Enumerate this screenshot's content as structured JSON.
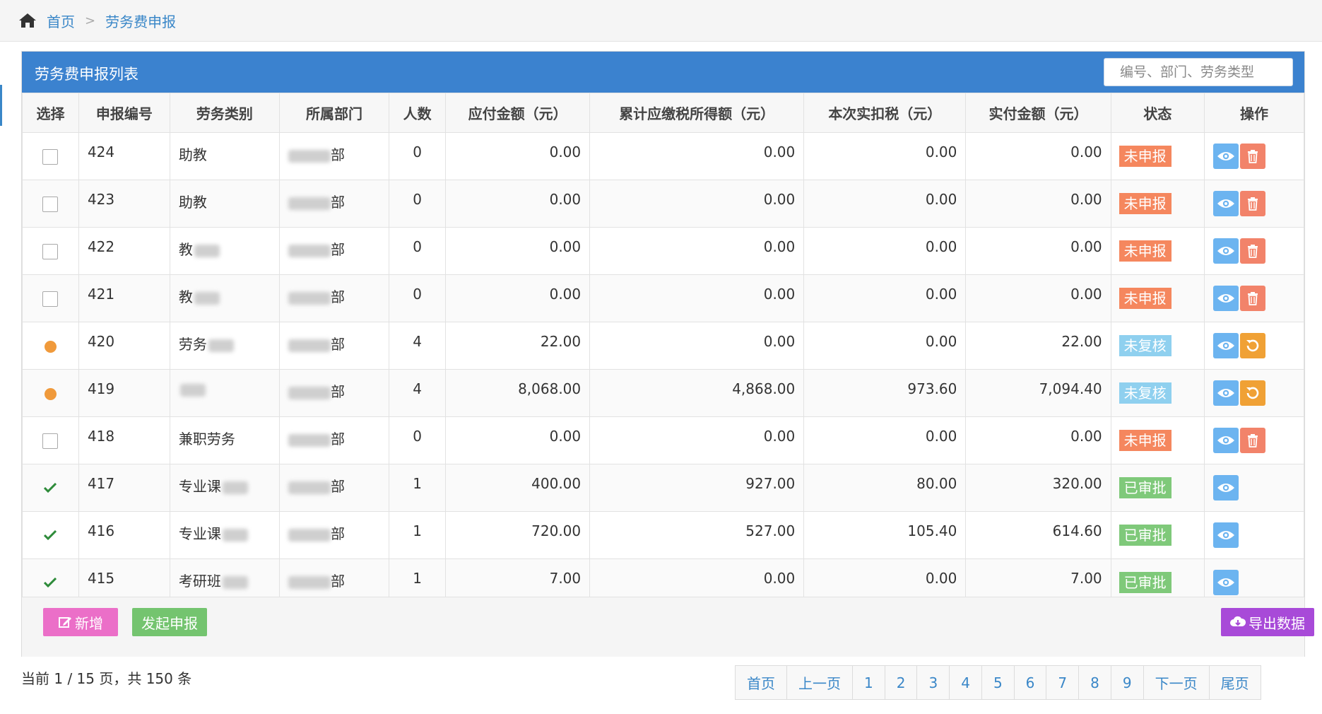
{
  "breadcrumb": {
    "home": "首页",
    "current": "劳务费申报"
  },
  "panel": {
    "title": "劳务费申报列表",
    "search_placeholder": "编号、部门、劳务类型"
  },
  "columns": [
    "选择",
    "申报编号",
    "劳务类别",
    "所属部门",
    "人数",
    "应付金额（元）",
    "累计应缴税所得额（元）",
    "本次实扣税（元）",
    "实付金额（元）",
    "状态",
    "操作"
  ],
  "rows": [
    {
      "select": "checkbox",
      "id": "424",
      "type": "助教",
      "type_blur": false,
      "dept": "部",
      "count": "0",
      "payable": "0.00",
      "taxable": "0.00",
      "tax": "0.00",
      "paid": "0.00",
      "status": "未申报",
      "status_color": "#f5875e",
      "actions": [
        "view-icon",
        "trash-icon"
      ]
    },
    {
      "select": "checkbox",
      "id": "423",
      "type": "助教",
      "type_blur": false,
      "dept": "部",
      "count": "0",
      "payable": "0.00",
      "taxable": "0.00",
      "tax": "0.00",
      "paid": "0.00",
      "status": "未申报",
      "status_color": "#f5875e",
      "actions": [
        "view-icon",
        "trash-icon"
      ]
    },
    {
      "select": "checkbox",
      "id": "422",
      "type": "教",
      "type_blur": true,
      "dept": "部",
      "count": "0",
      "payable": "0.00",
      "taxable": "0.00",
      "tax": "0.00",
      "paid": "0.00",
      "status": "未申报",
      "status_color": "#f5875e",
      "actions": [
        "view-icon",
        "trash-icon"
      ]
    },
    {
      "select": "checkbox",
      "id": "421",
      "type": "教",
      "type_blur": true,
      "dept": "部",
      "count": "0",
      "payable": "0.00",
      "taxable": "0.00",
      "tax": "0.00",
      "paid": "0.00",
      "status": "未申报",
      "status_color": "#f5875e",
      "actions": [
        "view-icon",
        "trash-icon"
      ]
    },
    {
      "select": "dot",
      "id": "420",
      "type": "劳务",
      "type_blur": true,
      "dept": "部",
      "count": "4",
      "payable": "22.00",
      "taxable": "0.00",
      "tax": "0.00",
      "paid": "22.00",
      "status": "未复核",
      "status_color": "#8fd0ef",
      "actions": [
        "view-icon",
        "undo-icon"
      ]
    },
    {
      "select": "dot",
      "id": "419",
      "type": "",
      "type_blur": true,
      "dept": "部",
      "count": "4",
      "payable": "8,068.00",
      "taxable": "4,868.00",
      "tax": "973.60",
      "paid": "7,094.40",
      "status": "未复核",
      "status_color": "#8fd0ef",
      "actions": [
        "view-icon",
        "undo-icon"
      ]
    },
    {
      "select": "checkbox",
      "id": "418",
      "type": "兼职劳务",
      "type_blur": false,
      "dept": "部",
      "count": "0",
      "payable": "0.00",
      "taxable": "0.00",
      "tax": "0.00",
      "paid": "0.00",
      "status": "未申报",
      "status_color": "#f5875e",
      "actions": [
        "view-icon",
        "trash-icon"
      ]
    },
    {
      "select": "check",
      "id": "417",
      "type": "专业课",
      "type_blur": true,
      "dept": "部",
      "count": "1",
      "payable": "400.00",
      "taxable": "927.00",
      "tax": "80.00",
      "paid": "320.00",
      "status": "已审批",
      "status_color": "#7fc97a",
      "actions": [
        "view-icon"
      ]
    },
    {
      "select": "check",
      "id": "416",
      "type": "专业课",
      "type_blur": true,
      "dept": "部",
      "count": "1",
      "payable": "720.00",
      "taxable": "527.00",
      "tax": "105.40",
      "paid": "614.60",
      "status": "已审批",
      "status_color": "#7fc97a",
      "actions": [
        "view-icon"
      ]
    },
    {
      "select": "check",
      "id": "415",
      "type": "考研班",
      "type_blur": true,
      "dept": "部",
      "count": "1",
      "payable": "7.00",
      "taxable": "0.00",
      "tax": "0.00",
      "paid": "7.00",
      "status": "已审批",
      "status_color": "#7fc97a",
      "actions": [
        "view-icon"
      ]
    }
  ],
  "footer": {
    "add_label": "新增",
    "submit_label": "发起申报",
    "export_label": "导出数据"
  },
  "pagination": {
    "info": "当前 1 / 15 页，共 150 条",
    "first": "首页",
    "prev": "上一页",
    "pages": [
      "1",
      "2",
      "3",
      "4",
      "5",
      "6",
      "7",
      "8",
      "9"
    ],
    "next": "下一页",
    "last": "尾页"
  }
}
